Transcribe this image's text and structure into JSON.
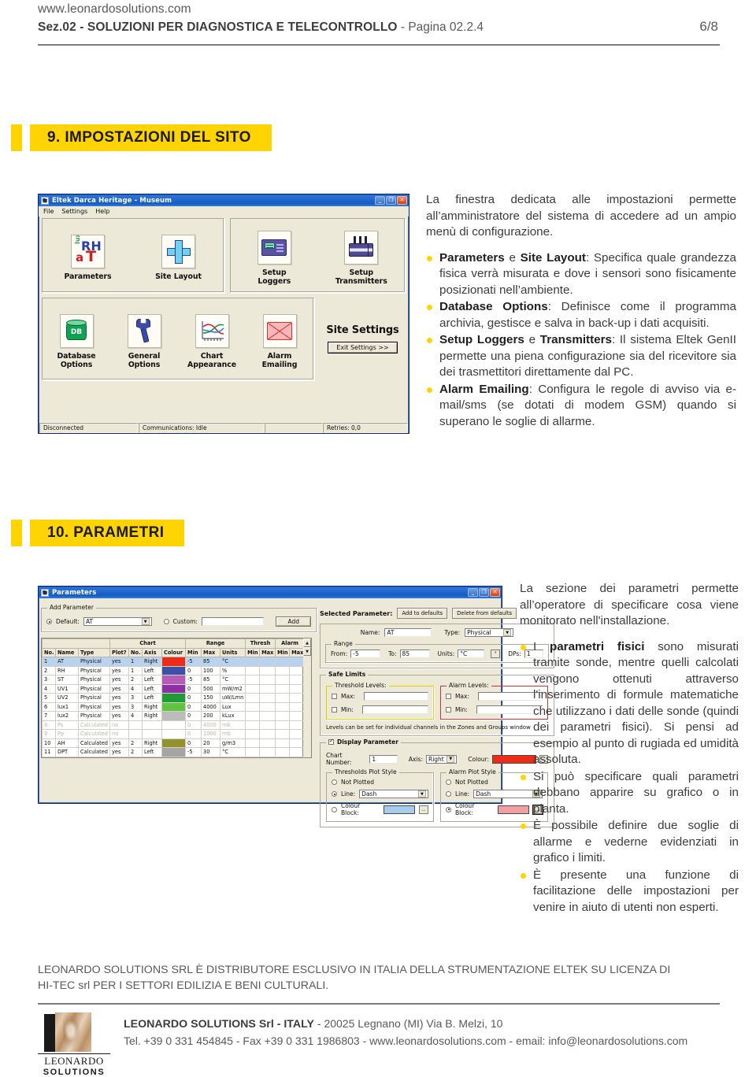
{
  "header": {
    "url": "www.leonardosolutions.com",
    "section": "Sez.02 - SOLUZIONI PER DIAGNOSTICA E TELECONTROLLO",
    "separator": "-",
    "page_label": "Pagina 02.2.4",
    "page_number": "6/8"
  },
  "section9": {
    "title": "9. IMPOSTAZIONI DEL SITO",
    "intro": "La finestra dedicata alle impostazioni permette all’amministratore del sistema di accedere ad un ampio menù di configurazione.",
    "bullets": [
      {
        "bold1": "Parameters",
        "mid": " e ",
        "bold2": "Site Layout",
        "rest": ": Specifica quale grandezza fisica verrà misurata e dove i sensori sono fisicamente posizionati nell’ambiente."
      },
      {
        "bold1": "Database Options",
        "mid": "",
        "bold2": "",
        "rest": ": Definisce come il programma archivia, gestisce e salva in back-up i dati acquisiti."
      },
      {
        "bold1": "Setup Loggers",
        "mid": " e ",
        "bold2": "Transmitters",
        "rest": ": Il sistema Eltek GenII permette una piena configurazione sia del ricevitore sia dei trasmettitori direttamente dal PC."
      },
      {
        "bold1": "Alarm Emailing",
        "mid": "",
        "bold2": "",
        "rest": ": Configura le regole di avviso via e-mail/sms (se dotati di modem GSM) quando si superano le soglie di allarme."
      }
    ]
  },
  "site_settings_window": {
    "title": "Eltek Darca Heritage - Museum",
    "title_icon": "app-icon",
    "menu": [
      "File",
      "Settings",
      "Help"
    ],
    "window_buttons": [
      "minimize",
      "maximize",
      "close"
    ],
    "icons_row1": [
      {
        "label": "Parameters",
        "icon": "rh-at-lux-icon",
        "glyph_lux": "lux",
        "glyph_rh": "RH",
        "glyph_a": "a",
        "glyph_t": "T"
      },
      {
        "label": "Site Layout",
        "icon": "cross-layout-icon"
      },
      {
        "label": "Setup\nLoggers",
        "label_l1": "Setup",
        "label_l2": "Loggers",
        "icon": "logger-device-icon"
      },
      {
        "label": "Setup\nTransmitters",
        "label_l1": "Setup",
        "label_l2": "Transmitters",
        "icon": "transmitter-icon"
      }
    ],
    "icons_row2": [
      {
        "label_l1": "Database",
        "label_l2": "Options",
        "icon": "database-icon",
        "glyph": "DB"
      },
      {
        "label_l1": "General",
        "label_l2": "Options",
        "icon": "wrench-icon"
      },
      {
        "label_l1": "Chart",
        "label_l2": "Appearance",
        "icon": "chart-icon"
      },
      {
        "label_l1": "Alarm",
        "label_l2": "Emailing",
        "icon": "envelope-icon"
      }
    ],
    "site_settings_label": "Site Settings",
    "exit_button": "Exit Settings >>",
    "status": {
      "connection": "Disconnected",
      "communications": "Communications: Idle",
      "spare": "",
      "retries": "Retries:  0,0"
    }
  },
  "section10": {
    "title": "10. PARAMETRI",
    "intro": "La sezione dei parametri permette all’operatore di specificare cosa viene monitorato nell'installazione.",
    "bullets": [
      {
        "pre": "I ",
        "bold1": "parametri fisici",
        "rest": " sono misurati tramite sonde, mentre quelli calcolati vengono ottenuti attraverso l'inserimento di formule matematiche che utilizzano i dati delle sonde (quindi dei parametri fisici). Si pensi ad esempio al punto di rugiada ed umidità assoluta."
      },
      {
        "pre": "",
        "bold1": "",
        "rest": "Si può specificare quali parametri debbano apparire su grafico o in pianta."
      },
      {
        "pre": "",
        "bold1": "",
        "rest": "È possibile definire due soglie di allarme e vederne evidenziati in grafico i limiti."
      },
      {
        "pre": "",
        "bold1": "",
        "rest": "È presente una funzione di facilitazione delle impostazioni per venire in aiuto di utenti non esperti."
      }
    ]
  },
  "parameters_window": {
    "title": "Parameters",
    "window_buttons": [
      "minimize",
      "maximize",
      "close"
    ],
    "add_parameter": {
      "legend": "Add Parameter",
      "default_radio_label": "Default:",
      "default_value": "AT",
      "custom_radio_label": "Custom:",
      "custom_value": "",
      "add_button": "Add"
    },
    "grid": {
      "group_headers": [
        "",
        "",
        "",
        "Chart",
        "Range",
        "Thresh",
        "Alarm"
      ],
      "columns": [
        "No.",
        "Name",
        "Type",
        "Plot?",
        "No.",
        "Axis",
        "Colour",
        "Min",
        "Max",
        "Units",
        "Min",
        "Max",
        "Min",
        "Max /"
      ],
      "rows": [
        {
          "no": "1",
          "name": "AT",
          "type": "Physical",
          "plot": "yes",
          "cno": "1",
          "axis": "Right",
          "colour": "#ee2a18",
          "min": "-5",
          "max": "85",
          "units": "°C",
          "tmin": "",
          "tmax": "",
          "amin": "",
          "amax": "",
          "selected": true,
          "dim": false
        },
        {
          "no": "2",
          "name": "RH",
          "type": "Physical",
          "plot": "yes",
          "cno": "1",
          "axis": "Left",
          "colour": "#3c50a8",
          "min": "0",
          "max": "100",
          "units": "%",
          "tmin": "",
          "tmax": "",
          "amin": "",
          "amax": "",
          "selected": false,
          "dim": false
        },
        {
          "no": "3",
          "name": "ST",
          "type": "Physical",
          "plot": "yes",
          "cno": "2",
          "axis": "Left",
          "colour": "#b55bb8",
          "min": "-5",
          "max": "85",
          "units": "°C",
          "tmin": "",
          "tmax": "",
          "amin": "",
          "amax": "",
          "selected": false,
          "dim": false
        },
        {
          "no": "4",
          "name": "UV1",
          "type": "Physical",
          "plot": "yes",
          "cno": "4",
          "axis": "Left",
          "colour": "#8e2fa8",
          "min": "0",
          "max": "500",
          "units": "mW/m2",
          "tmin": "",
          "tmax": "",
          "amin": "",
          "amax": "",
          "selected": false,
          "dim": false
        },
        {
          "no": "5",
          "name": "UV2",
          "type": "Physical",
          "plot": "yes",
          "cno": "3",
          "axis": "Left",
          "colour": "#1f9a35",
          "min": "0",
          "max": "150",
          "units": "uW/Lmn",
          "tmin": "",
          "tmax": "",
          "amin": "",
          "amax": "",
          "selected": false,
          "dim": false
        },
        {
          "no": "6",
          "name": "lux1",
          "type": "Physical",
          "plot": "yes",
          "cno": "3",
          "axis": "Right",
          "colour": "#5fc53f",
          "min": "0",
          "max": "4000",
          "units": "Lux",
          "tmin": "",
          "tmax": "",
          "amin": "",
          "amax": "",
          "selected": false,
          "dim": false
        },
        {
          "no": "7",
          "name": "lux2",
          "type": "Physical",
          "plot": "yes",
          "cno": "4",
          "axis": "Right",
          "colour": "#bcbcbc",
          "min": "0",
          "max": "200",
          "units": "kLux",
          "tmin": "",
          "tmax": "",
          "amin": "",
          "amax": "",
          "selected": false,
          "dim": false
        },
        {
          "no": "8",
          "name": "Ps",
          "type": "Calculated",
          "plot": "no",
          "cno": "",
          "axis": "",
          "colour": "",
          "min": "0",
          "max": "4000",
          "units": "mb",
          "tmin": "",
          "tmax": "",
          "amin": "",
          "amax": "",
          "selected": false,
          "dim": true
        },
        {
          "no": "9",
          "name": "Pp",
          "type": "Calculated",
          "plot": "no",
          "cno": "",
          "axis": "",
          "colour": "",
          "min": "0",
          "max": "1000",
          "units": "mb",
          "tmin": "",
          "tmax": "",
          "amin": "",
          "amax": "",
          "selected": false,
          "dim": true
        },
        {
          "no": "10",
          "name": "AH",
          "type": "Calculated",
          "plot": "yes",
          "cno": "2",
          "axis": "Right",
          "colour": "#93922a",
          "min": "0",
          "max": "20",
          "units": "g/m3",
          "tmin": "",
          "tmax": "",
          "amin": "",
          "amax": "",
          "selected": false,
          "dim": false
        },
        {
          "no": "11",
          "name": "DPT",
          "type": "Calculated",
          "plot": "yes",
          "cno": "2",
          "axis": "Left",
          "colour": "#a5a5a5",
          "min": "-5",
          "max": "30",
          "units": "°C",
          "tmin": "",
          "tmax": "",
          "amin": "",
          "amax": "",
          "selected": false,
          "dim": false
        }
      ]
    },
    "selected_parameter": {
      "label": "Selected Parameter:",
      "add_defaults_button": "Add to defaults",
      "delete_defaults_button": "Delete from defaults",
      "name_label": "Name:",
      "name_value": "AT",
      "type_label": "Type:",
      "type_value": "Physical",
      "range_legend": "Range",
      "from_label": "From:",
      "from_value": "-5",
      "to_label": "To:",
      "to_value": "85",
      "units_label": "Units:",
      "units_value": "°C",
      "degree_button": "°",
      "dps_label": "DPs:",
      "dps_value": "1"
    },
    "safe_limits": {
      "legend": "Safe Limits",
      "threshold_legend": "Threshold Levels:",
      "threshold_accent": "#e0d000",
      "alarm_legend": "Alarm Levels:",
      "alarm_accent": "#d83030",
      "max_label": "Max:",
      "min_label": "Min:",
      "threshold_max_value": "",
      "threshold_min_value": "",
      "alarm_max_value": "",
      "alarm_min_value": "",
      "note": "Levels can be set for individual channels in the Zones and Groups window"
    },
    "display_parameter": {
      "legend": "Display Parameter",
      "checked": true,
      "chart_number_label": "Chart Number:",
      "chart_number_value": "1",
      "axis_label": "Axis:",
      "axis_value": "Right",
      "colour_label": "Colour:",
      "colour_value": "#ee2a18",
      "browse_button": "...",
      "thresholds_plot_legend": "Thresholds Plot Style",
      "alarm_plot_legend": "Alarm Plot Style",
      "not_plotted_label": "Not Plotted",
      "line_label": "Line:",
      "colour_block_label": "Colour Block:",
      "threshold_style": {
        "selected": "line",
        "line_value": "Dash",
        "block_colour": "#a8cdea"
      },
      "alarm_style": {
        "selected": "block",
        "line_value": "Dash",
        "block_colour": "#f0a0a0"
      }
    }
  },
  "footer": {
    "note_line1": "LEONARDO SOLUTIONS SRL È DISTRIBUTORE ESCLUSIVO IN ITALIA DELLA STRUMENTAZIONE ELTEK SU LICENZA DI",
    "note_line2": "HI-TEC srl PER I SETTORI EDILIZIA E BENI CULTURALI.",
    "logo_name": "LEONARDO",
    "logo_sub": "SOLUTIONS",
    "company_bold": "LEONARDO SOLUTIONS Srl - ITALY",
    "company_rest": " - 20025 Legnano (MI)  Via B. Melzi, 10",
    "contacts": "Tel. +39 0 331 454845 - Fax +39 0 331 1986803 - www.leonardosolutions.com - email: info@leonardosolutions.com"
  }
}
